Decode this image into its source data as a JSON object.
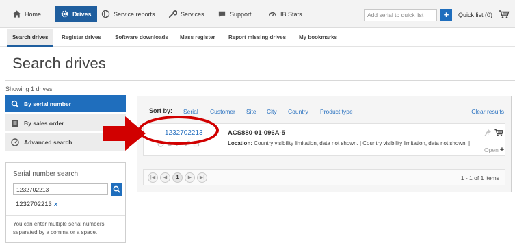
{
  "nav": {
    "items": [
      {
        "label": "Home",
        "icon": "home-icon"
      },
      {
        "label": "Drives",
        "icon": "gear-icon",
        "active": true
      },
      {
        "label": "Service reports",
        "icon": "globe-icon"
      },
      {
        "label": "Services",
        "icon": "wrench-icon"
      },
      {
        "label": "Support",
        "icon": "chat-icon"
      },
      {
        "label": "IB Stats",
        "icon": "gauge-icon"
      }
    ],
    "quick_placeholder": "Add serial to quick list",
    "quick_add_label": "+",
    "quick_list_label": "Quick list (0)"
  },
  "subnav": {
    "items": [
      "Search drives",
      "Register drives",
      "Software downloads",
      "Mass register",
      "Report missing drives",
      "My bookmarks"
    ]
  },
  "page": {
    "title": "Search drives",
    "showing": "Showing 1 drives"
  },
  "sidebar": {
    "items": [
      {
        "label": "By serial number",
        "icon": "search-icon",
        "active": true
      },
      {
        "label": "By sales order",
        "icon": "document-icon"
      },
      {
        "label": "Advanced search",
        "icon": "gauge-icon"
      }
    ],
    "serial_search": {
      "title": "Serial number search",
      "input_value": "1232702213",
      "tag": "1232702213",
      "tag_remove": "x",
      "help": "You can enter multiple serial numbers separated by a comma or a space."
    }
  },
  "results": {
    "sort_label": "Sort by:",
    "sort_options": [
      "Serial",
      "Customer",
      "Site",
      "City",
      "Country",
      "Product type"
    ],
    "clear_label": "Clear results",
    "item": {
      "serial": "1232702213",
      "product": "ACS880-01-096A-5",
      "location_label": "Location:",
      "location_text": "Country visibility limitation, data not shown. | Country visibility limitation, data not shown. |",
      "open_label": "Open",
      "open_plus": "+"
    },
    "pager": {
      "first": "|◀",
      "prev": "◀",
      "current_page": "1",
      "next": "▶",
      "last": "▶|",
      "info": "1 - 1 of 1 items"
    }
  },
  "colors": {
    "brand_blue": "#1f6ebd",
    "link_blue": "#2a72c0",
    "annotation_red": "#d10000"
  }
}
